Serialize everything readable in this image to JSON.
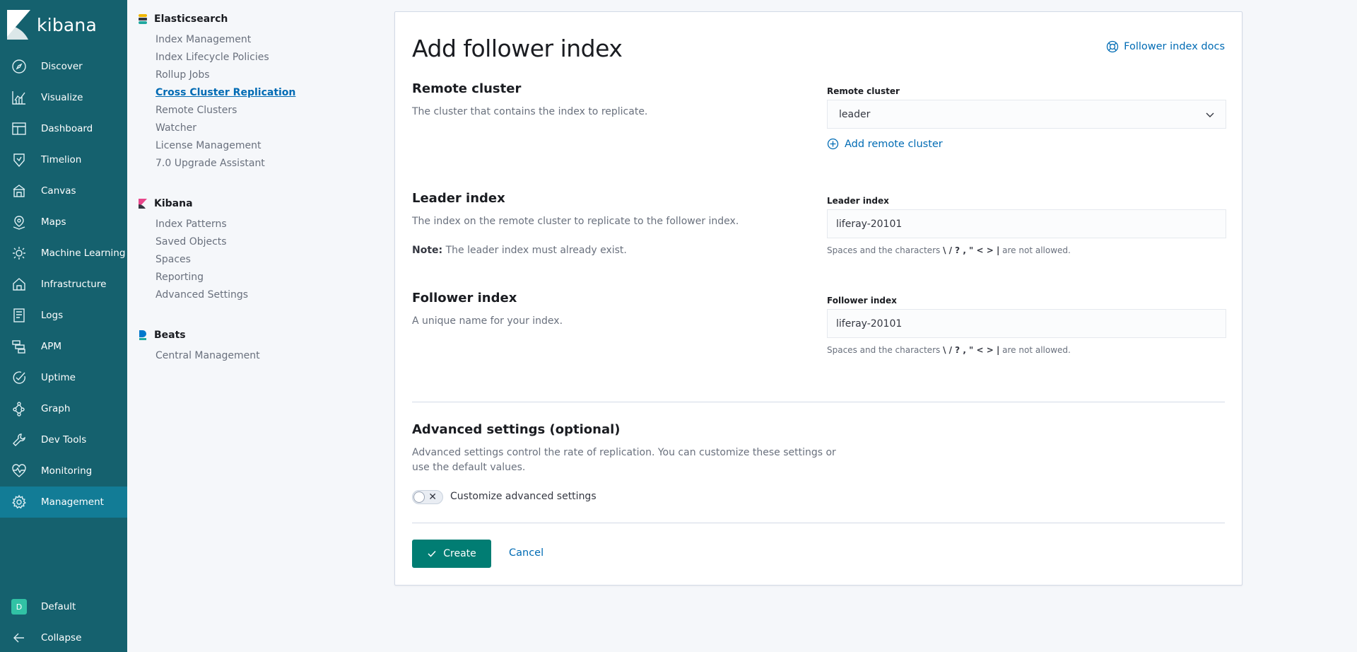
{
  "app": {
    "name": "kibana"
  },
  "leftnav": {
    "items": [
      {
        "label": "Discover",
        "icon": "compass-icon"
      },
      {
        "label": "Visualize",
        "icon": "visualize-icon"
      },
      {
        "label": "Dashboard",
        "icon": "dashboard-icon"
      },
      {
        "label": "Timelion",
        "icon": "timelion-icon"
      },
      {
        "label": "Canvas",
        "icon": "canvas-icon"
      },
      {
        "label": "Maps",
        "icon": "maps-icon"
      },
      {
        "label": "Machine Learning",
        "icon": "machine-learning-icon"
      },
      {
        "label": "Infrastructure",
        "icon": "infrastructure-icon"
      },
      {
        "label": "Logs",
        "icon": "logs-icon"
      },
      {
        "label": "APM",
        "icon": "apm-icon"
      },
      {
        "label": "Uptime",
        "icon": "uptime-icon"
      },
      {
        "label": "Graph",
        "icon": "graph-icon"
      },
      {
        "label": "Dev Tools",
        "icon": "dev-tools-icon"
      },
      {
        "label": "Monitoring",
        "icon": "monitoring-icon"
      },
      {
        "label": "Management",
        "icon": "gear-icon",
        "active": true
      }
    ],
    "space": {
      "initial": "D",
      "label": "Default"
    },
    "collapse_label": "Collapse"
  },
  "management": {
    "elasticsearch": {
      "title": "Elasticsearch",
      "links": [
        "Index Management",
        "Index Lifecycle Policies",
        "Rollup Jobs",
        "Cross Cluster Replication",
        "Remote Clusters",
        "Watcher",
        "License Management",
        "7.0 Upgrade Assistant"
      ],
      "current": "Cross Cluster Replication"
    },
    "kibana": {
      "title": "Kibana",
      "links": [
        "Index Patterns",
        "Saved Objects",
        "Spaces",
        "Reporting",
        "Advanced Settings"
      ]
    },
    "beats": {
      "title": "Beats",
      "links": [
        "Central Management"
      ]
    }
  },
  "form": {
    "title": "Add follower index",
    "docs_link": "Follower index docs",
    "remote_cluster": {
      "title": "Remote cluster",
      "desc": "The cluster that contains the index to replicate.",
      "label": "Remote cluster",
      "value": "leader",
      "add_link": "Add remote cluster"
    },
    "leader_index": {
      "title": "Leader index",
      "desc": "The index on the remote cluster to replicate to the follower index.",
      "note_label": "Note:",
      "note_text": " The leader index must already exist.",
      "label": "Leader index",
      "value": "liferay-20101",
      "help_prefix": "Spaces and the characters ",
      "help_chars": "\\ / ? , \" < > |",
      "help_suffix": " are not allowed."
    },
    "follower_index": {
      "title": "Follower index",
      "desc": "A unique name for your index.",
      "label": "Follower index",
      "value": "liferay-20101",
      "help_prefix": "Spaces and the characters ",
      "help_chars": "\\ / ? , \" < > |",
      "help_suffix": " are not allowed."
    },
    "advanced": {
      "title": "Advanced settings (optional)",
      "desc_line1": "Advanced settings control the rate of replication. You can customize these settings or",
      "desc_line2": "use the default values.",
      "toggle_label": "Customize advanced settings",
      "toggle_on": false
    },
    "create_label": "Create",
    "cancel_label": "Cancel"
  },
  "colors": {
    "nav_bg": "#15616e",
    "nav_active": "#127c96",
    "primary": "#017d73",
    "link": "#006bb4"
  }
}
